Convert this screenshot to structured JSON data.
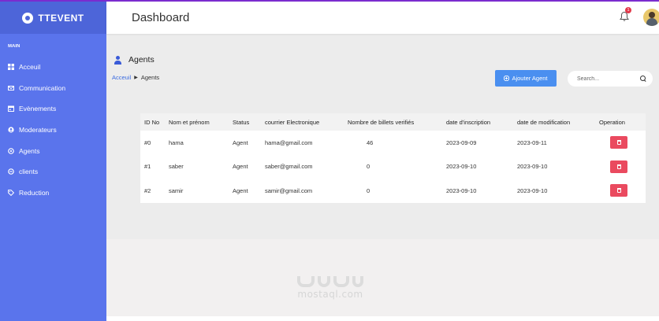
{
  "app": {
    "brand": "TTEVENT"
  },
  "sidebar": {
    "section_label": "MAIN",
    "items": [
      {
        "label": "Acceuil",
        "icon": "grid-icon"
      },
      {
        "label": "Communication",
        "icon": "mail-icon"
      },
      {
        "label": "Evènements",
        "icon": "calendar-icon"
      },
      {
        "label": "Moderateurs",
        "icon": "moderator-icon"
      },
      {
        "label": "Agents",
        "icon": "agent-icon"
      },
      {
        "label": "clients",
        "icon": "client-icon"
      },
      {
        "label": "Reduction",
        "icon": "tag-icon"
      }
    ]
  },
  "header": {
    "title": "Dashboard",
    "notification_count": "1"
  },
  "main": {
    "section_title": "Agents",
    "breadcrumb": {
      "home": "Acceuil",
      "current": "Agents"
    },
    "add_button_label": "Ajouter Agent",
    "search_placeholder": "Search..."
  },
  "table": {
    "columns": [
      "ID No",
      "Nom et prénom",
      "Status",
      "courrier Electronique",
      "Nombre de billets verifiés",
      "date d'inscription",
      "date de modification",
      "Operation"
    ],
    "rows": [
      {
        "id": "#0",
        "name": "hama",
        "status": "Agent",
        "email": "hama@gmail.com",
        "tickets": "46",
        "created": "2023-09-09",
        "modified": "2023-09-11"
      },
      {
        "id": "#1",
        "name": "saber",
        "status": "Agent",
        "email": "saber@gmail.com",
        "tickets": "0",
        "created": "2023-09-10",
        "modified": "2023-09-10"
      },
      {
        "id": "#2",
        "name": "samir",
        "status": "Agent",
        "email": "samir@gmail.com",
        "tickets": "0",
        "created": "2023-09-10",
        "modified": "2023-09-10"
      }
    ]
  },
  "watermark": {
    "text": "mostaql.com"
  },
  "colors": {
    "sidebar": "#5a74ec",
    "primary_button": "#4a8ff0",
    "delete_button": "#ea4a5f",
    "link": "#3a6be0"
  }
}
